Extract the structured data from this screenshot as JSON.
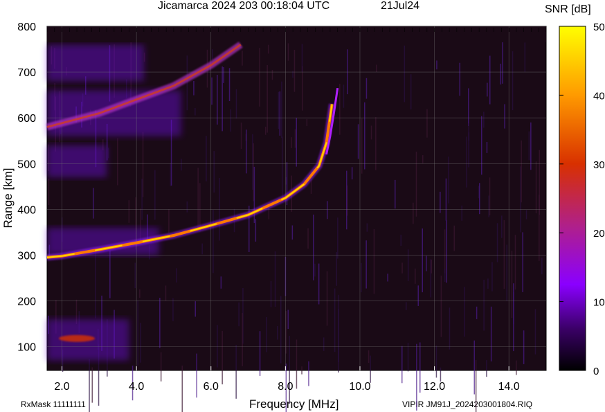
{
  "chart_data": {
    "type": "heatmap",
    "title": "Jicamarca 2024 203 00:18:04 UTC",
    "date": "21Jul24",
    "xlabel": "Frequency [MHz]",
    "ylabel": "Range [km]",
    "xlim": [
      1.6,
      15.0
    ],
    "ylim": [
      48,
      800
    ],
    "xticks": [
      "2.0",
      "4.0",
      "6.0",
      "8.0",
      "10.0",
      "12.0",
      "14.0"
    ],
    "yticks": [
      "100",
      "200",
      "300",
      "400",
      "500",
      "600",
      "700",
      "800"
    ],
    "colorbar": {
      "label": "SNR [dB]",
      "range": [
        0,
        50
      ],
      "ticks": [
        "0",
        "10",
        "20",
        "30",
        "40",
        "50"
      ],
      "colors": [
        "#000000",
        "#3a0066",
        "#8a00ff",
        "#b0208a",
        "#d83000",
        "#ff9a00",
        "#ffff00"
      ]
    },
    "traces": [
      {
        "name": "",
        "x": [
          1.6,
          2.0,
          3.0,
          4.0,
          5.0,
          6.0,
          7.0,
          8.0,
          8.5,
          8.9,
          9.1,
          9.25
        ],
        "y": [
          295,
          298,
          312,
          327,
          343,
          365,
          388,
          425,
          455,
          495,
          545,
          630
        ]
      },
      {
        "name": "",
        "x": [
          9.1,
          9.2,
          9.3,
          9.4
        ],
        "y": [
          520,
          560,
          610,
          665
        ]
      },
      {
        "name": "",
        "x": [
          1.6,
          3.0,
          4.0,
          5.0,
          6.0,
          6.8
        ],
        "y": [
          580,
          610,
          640,
          670,
          715,
          760
        ]
      }
    ],
    "grid": true
  },
  "footer": {
    "rxmask": "RxMask 11111111",
    "file": "VIPIR  JM91J_2024203001804.RIQ"
  }
}
